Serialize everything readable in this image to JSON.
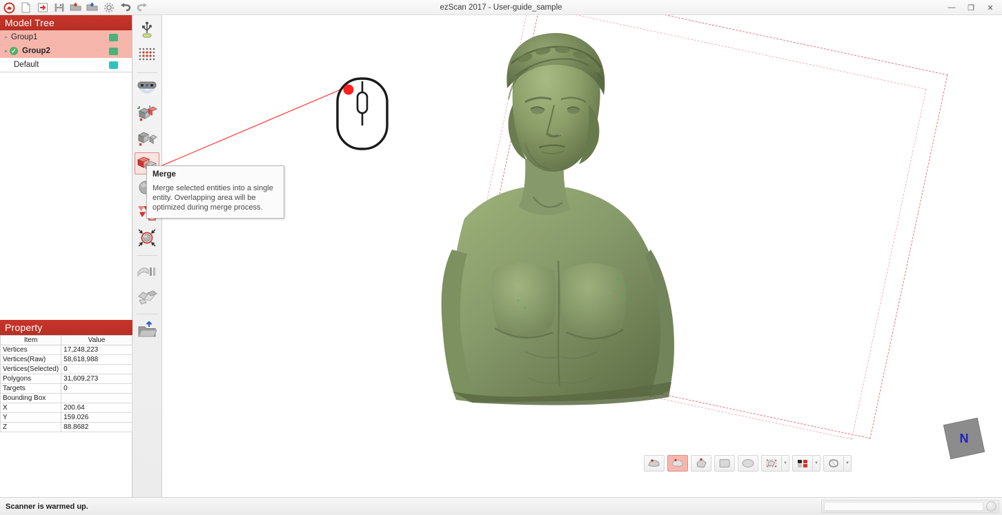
{
  "window": {
    "title": "ezScan 2017 - User-guide_sample",
    "minimize": "—",
    "maximize": "❐",
    "close": "✕"
  },
  "top_toolbar": {
    "items": [
      {
        "name": "app-logo-icon",
        "label": "ezScan"
      },
      {
        "name": "new-file-icon",
        "label": "New"
      },
      {
        "name": "import-icon",
        "label": "Import"
      },
      {
        "name": "save-icon",
        "label": "Save"
      },
      {
        "name": "open-red-icon",
        "label": "Open Project"
      },
      {
        "name": "open-blue-icon",
        "label": "Export"
      },
      {
        "name": "settings-gear-icon",
        "label": "Settings"
      },
      {
        "name": "undo-icon",
        "label": "Undo"
      },
      {
        "name": "redo-icon",
        "label": "Redo"
      }
    ]
  },
  "model_tree": {
    "title": "Model Tree",
    "rows": [
      {
        "label": "Group1",
        "selected": true,
        "checked": false,
        "bold": false,
        "swatch": "#4fb07a"
      },
      {
        "label": "Group2",
        "selected": true,
        "checked": true,
        "bold": true,
        "swatch": "#4fb07a"
      },
      {
        "label": "Default",
        "selected": false,
        "checked": false,
        "bold": false,
        "swatch": "#33c0c0"
      }
    ]
  },
  "property": {
    "title": "Property",
    "columns": [
      "Item",
      "Value"
    ],
    "rows": [
      {
        "item": "Vertices",
        "value": "17,248,223"
      },
      {
        "item": "Vertices(Raw)",
        "value": "58,618,988"
      },
      {
        "item": "Vertices(Selected)",
        "value": "0"
      },
      {
        "item": "Polygons",
        "value": "31,609,273"
      },
      {
        "item": "Targets",
        "value": "0"
      },
      {
        "item": "Bounding Box",
        "value": ""
      },
      {
        "item": "X",
        "value": "200.64"
      },
      {
        "item": "Y",
        "value": "159.026"
      },
      {
        "item": "Z",
        "value": "88.8682"
      }
    ]
  },
  "side_toolbar": {
    "items": [
      {
        "name": "usb-connect-icon",
        "label": "Connect Scanner"
      },
      {
        "name": "calibration-dots-icon",
        "label": "Calibration"
      },
      {
        "name": "scanner-device-icon",
        "label": "Scan"
      },
      {
        "name": "align-axes-icon",
        "label": "Align"
      },
      {
        "name": "align-manual-icon",
        "label": "Manual Align"
      },
      {
        "name": "merge-icon",
        "label": "Merge",
        "active": true
      },
      {
        "name": "fill-holes-icon",
        "label": "Fill Holes"
      },
      {
        "name": "delete-selection-icon",
        "label": "Delete Selection"
      },
      {
        "name": "optimize-icon",
        "label": "Optimize"
      },
      {
        "name": "smooth-icon",
        "label": "Smooth"
      },
      {
        "name": "decimate-icon",
        "label": "Decimate"
      },
      {
        "name": "export-folder-icon",
        "label": "Export"
      }
    ]
  },
  "tooltip": {
    "title": "Merge",
    "body": "Merge selected entities into a single entity. Overlapping area will be optimized during merge process."
  },
  "view_toolbar": {
    "buttons": [
      {
        "name": "view-shaded-wireframe-icon",
        "label": "Shaded Wireframe",
        "active": false,
        "arrow": false
      },
      {
        "name": "view-shaded-icon",
        "label": "Shaded",
        "active": true,
        "arrow": false
      },
      {
        "name": "view-points-icon",
        "label": "Points",
        "active": false,
        "arrow": false
      },
      {
        "name": "view-flat-icon",
        "label": "Flat",
        "active": false,
        "arrow": false
      },
      {
        "name": "view-smooth-icon",
        "label": "Smooth",
        "active": false,
        "arrow": false
      },
      {
        "name": "view-bounding-box-icon",
        "label": "Bounding Box",
        "active": false,
        "arrow": true
      },
      {
        "name": "view-color-map-icon",
        "label": "Color Map",
        "active": false,
        "arrow": true
      },
      {
        "name": "view-transparent-icon",
        "label": "Transparent",
        "active": false,
        "arrow": true
      }
    ]
  },
  "nav_cube": {
    "label": "N"
  },
  "status": {
    "message": "Scanner is warmed up."
  },
  "colors": {
    "accent_red": "#c9342a",
    "selection_pink": "#f7b6ab",
    "model_green": "#8a9e68",
    "bbox_red": "#e8737f",
    "nav_blue": "#2020c0"
  }
}
